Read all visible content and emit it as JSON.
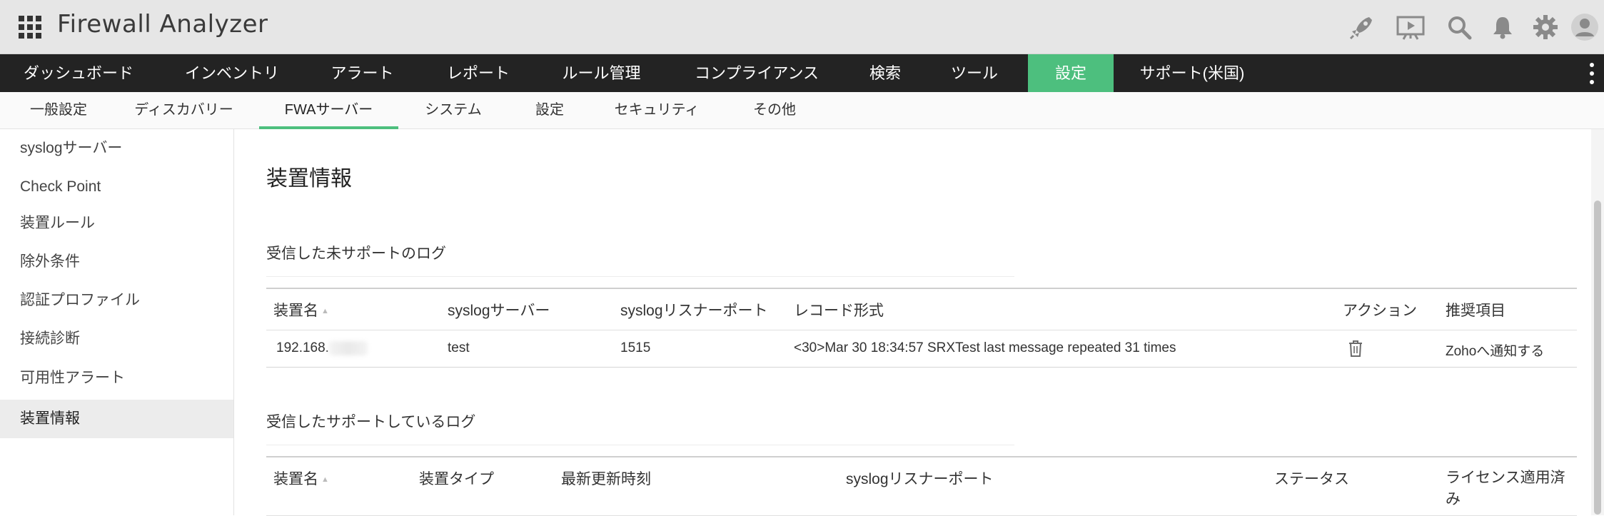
{
  "app": {
    "title": "Firewall Analyzer"
  },
  "top_icons": [
    "rocket-icon",
    "presentation-icon",
    "search-icon",
    "bell-icon",
    "gear-icon",
    "user-avatar-icon"
  ],
  "main_nav": {
    "items": [
      "ダッシュボード",
      "インベントリ",
      "アラート",
      "レポート",
      "ルール管理",
      "コンプライアンス",
      "検索",
      "ツール",
      "設定",
      "サポート(米国)"
    ],
    "active": "設定",
    "accent_color": "#4dbf7e"
  },
  "sub_nav": {
    "items": [
      "一般設定",
      "ディスカバリー",
      "FWAサーバー",
      "システム",
      "設定",
      "セキュリティ",
      "その他"
    ],
    "active": "FWAサーバー"
  },
  "sidebar": {
    "items": [
      "syslogサーバー",
      "Check Point",
      "装置ルール",
      "除外条件",
      "認証プロファイル",
      "接続診断",
      "可用性アラート",
      "装置情報"
    ],
    "active": "装置情報"
  },
  "page": {
    "title": "装置情報"
  },
  "unsupported_logs": {
    "title": "受信した未サポートのログ",
    "columns": [
      "装置名",
      "syslogサーバー",
      "syslogリスナーポート",
      "レコード形式",
      "アクション",
      "推奨項目"
    ],
    "rows": [
      {
        "device": "192.168.",
        "server": "test",
        "port": "1515",
        "record": "<30>Mar 30 18:34:57 SRXTest last message repeated 31 times",
        "action_icon": "trash-icon",
        "recommendation": "Zohoへ通知する"
      }
    ]
  },
  "supported_logs": {
    "title": "受信したサポートしているログ",
    "columns": [
      "装置名",
      "装置タイプ",
      "最新更新時刻",
      "syslogリスナーポート",
      "ステータス",
      "ライセンス適用済",
      "み"
    ]
  }
}
